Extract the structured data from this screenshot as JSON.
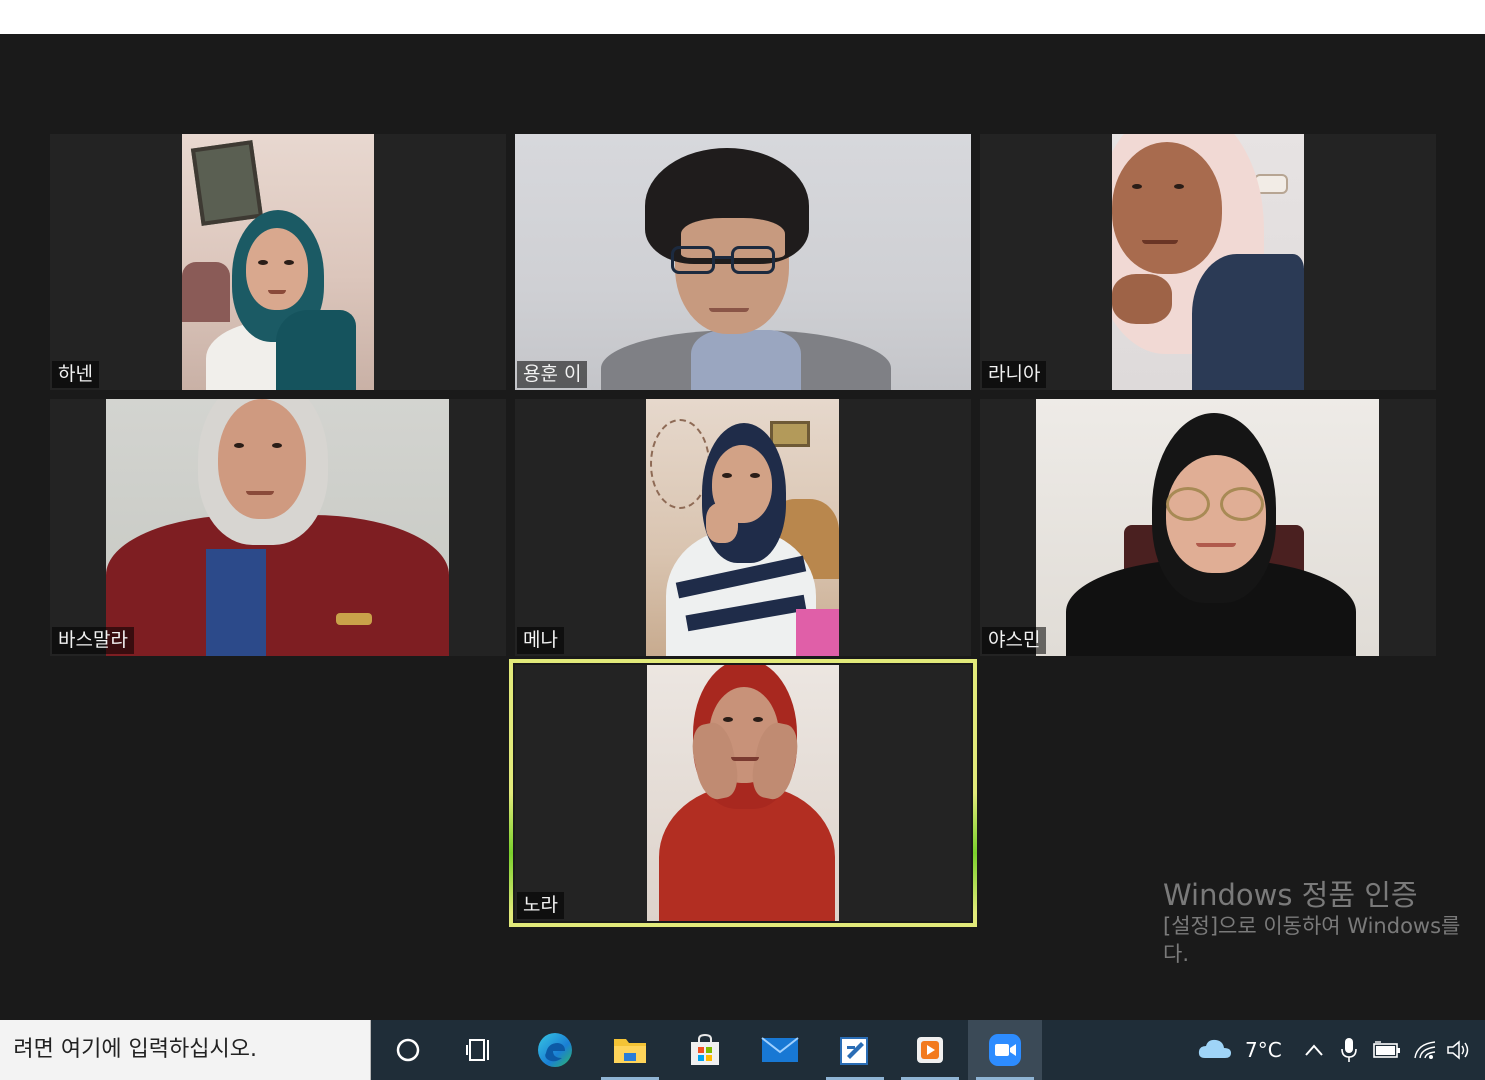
{
  "meeting": {
    "participants": [
      {
        "name": "하넨"
      },
      {
        "name": "용훈 이"
      },
      {
        "name": "라니아"
      },
      {
        "name": "바스말라"
      },
      {
        "name": "메나"
      },
      {
        "name": "야스민"
      },
      {
        "name": "노라"
      }
    ],
    "active_speaker": "노라"
  },
  "activation_watermark": {
    "title": "Windows 정품 인증",
    "line1": "[설정]으로 이동하여 Windows를",
    "line2": "다."
  },
  "taskbar": {
    "search_text": "려면 여기에 입력하십시오.",
    "apps": [
      {
        "icon": "cortana-circle-icon"
      },
      {
        "icon": "task-view-icon"
      },
      {
        "icon": "edge-icon"
      },
      {
        "icon": "file-explorer-icon"
      },
      {
        "icon": "microsoft-store-icon"
      },
      {
        "icon": "mail-icon"
      },
      {
        "icon": "pen-app-icon"
      },
      {
        "icon": "media-player-icon"
      },
      {
        "icon": "zoom-icon"
      }
    ],
    "weather": {
      "temperature": "7°C",
      "icon": "cloud-icon"
    },
    "tray_icons": [
      "chevron-up-icon",
      "microphone-icon",
      "battery-icon",
      "wifi-icon",
      "speaker-icon"
    ]
  },
  "colors": {
    "meeting_background": "#1a1a1a",
    "tile_background": "#232323",
    "active_speaker_border": "#e2ea7a",
    "taskbar": "#1f2d38",
    "zoom_blue": "#2d8cff"
  }
}
